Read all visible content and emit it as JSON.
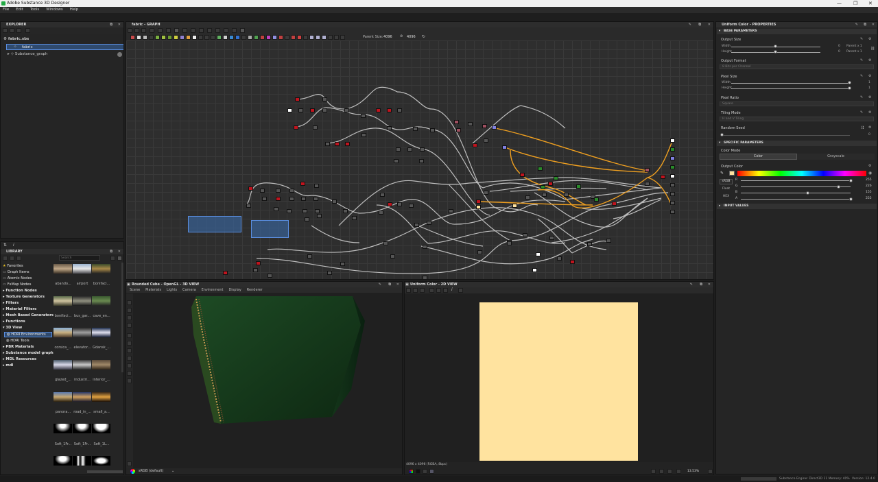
{
  "window": {
    "title": "Adobe Substance 3D Designer",
    "controls": [
      "—",
      "❐",
      "✕"
    ]
  },
  "menu": [
    "File",
    "Edit",
    "Tools",
    "Windows",
    "Help"
  ],
  "explorer": {
    "title": "EXPLORER",
    "file": "fabric.sbs",
    "items": [
      "fabric",
      "Substance_graph"
    ]
  },
  "library": {
    "title": "LIBRARY",
    "search_placeholder": "Search",
    "categories": [
      {
        "label": "Favorites",
        "bold": false
      },
      {
        "label": "Graph Items",
        "bold": false
      },
      {
        "label": "Atomic Nodes",
        "bold": false
      },
      {
        "label": "FxMap Nodes",
        "bold": false
      },
      {
        "label": "Function Nodes",
        "bold": true
      },
      {
        "label": "Texture Generators",
        "bold": true
      },
      {
        "label": "Filters",
        "bold": true
      },
      {
        "label": "Material Filters",
        "bold": true
      },
      {
        "label": "Mesh Based Generators",
        "bold": true
      },
      {
        "label": "Functions",
        "bold": true
      },
      {
        "label": "3D View",
        "bold": true
      },
      {
        "label": "HDRI Environments",
        "bold": false
      },
      {
        "label": "HDRI Tools",
        "bold": false
      },
      {
        "label": "PBR Materials",
        "bold": true
      },
      {
        "label": "Substance model graph",
        "bold": true
      },
      {
        "label": "MDL Resources",
        "bold": true
      },
      {
        "label": "mdl",
        "bold": true
      }
    ],
    "thumb_labels": [
      [
        "abando...",
        "airport",
        "bonifaci..."
      ],
      [
        "bonifaci...",
        "bus_gar...",
        "cave_en..."
      ],
      [
        "corsica_...",
        "elevator...",
        "Gdansk_..."
      ],
      [
        "glazed_...",
        "industri...",
        "interior_..."
      ],
      [
        "panora...",
        "road_in_...",
        "small_a..."
      ],
      [
        "Soft_1Fr...",
        "Soft_1Fr...",
        "Soft_1L..."
      ]
    ]
  },
  "graph": {
    "title": "fabric - GRAPH",
    "parent_size_label": "Parent Size:",
    "parent_size_value": "4096",
    "size_value": "4096"
  },
  "view3d": {
    "title": "Rounded Cube - OpenGL - 3D VIEW",
    "tabs": [
      "Scene",
      "Materials",
      "Lights",
      "Camera",
      "Environment",
      "Display",
      "Renderer"
    ],
    "colorspace": "sRGB (default)"
  },
  "view2d": {
    "title": "Uniform Color - 2D VIEW",
    "info": "4096 x 4096 (RGBA, 8bpc)",
    "zoom": "13.53%",
    "swatch_color": "#ffe39f"
  },
  "properties": {
    "title": "Uniform Color - PROPERTIES",
    "base_section": "BASE PARAMETERS",
    "output_size": "Output Size",
    "width_label": "Width",
    "height_label": "Height",
    "width_value": "0",
    "height_value": "0",
    "parent_x1": "Parent x 1",
    "output_format": "Output Format",
    "output_format_value": "8 Bits per Channel",
    "pixel_size": "Pixel Size",
    "pixel_width_value": "1",
    "pixel_height_value": "1",
    "pixel_ratio": "Pixel Ratio",
    "pixel_ratio_value": "Square",
    "tiling_mode": "Tiling Mode",
    "tiling_value": "H and V Tiling",
    "random_seed": "Random Seed",
    "random_seed_value": "0",
    "specific_section": "SPECIFIC PARAMETERS",
    "color_mode": "Color Mode",
    "color_tab": "Color",
    "grayscale_tab": "Grayscale",
    "output_color": "Output Color",
    "srgb_btn": "sRGB",
    "float_btn": "Float",
    "hex_btn": "HEX",
    "channels": [
      {
        "ch": "R",
        "value": "255",
        "level": 1.0
      },
      {
        "ch": "G",
        "value": "226",
        "level": 0.886
      },
      {
        "ch": "B",
        "value": "155",
        "level": 0.608
      },
      {
        "ch": "A",
        "value": "255",
        "level": 1.0
      }
    ],
    "input_section": "INPUT VALUES"
  },
  "status": {
    "engine": "Substance Engine: Direct3D 11 Memory: 40%",
    "version": "Version: 12.4.0"
  },
  "colors": {
    "accent": "#5a8ee0",
    "orange_wire": "#f0a020",
    "node_red": "#c0141e",
    "selection": "#3a6aa8"
  }
}
